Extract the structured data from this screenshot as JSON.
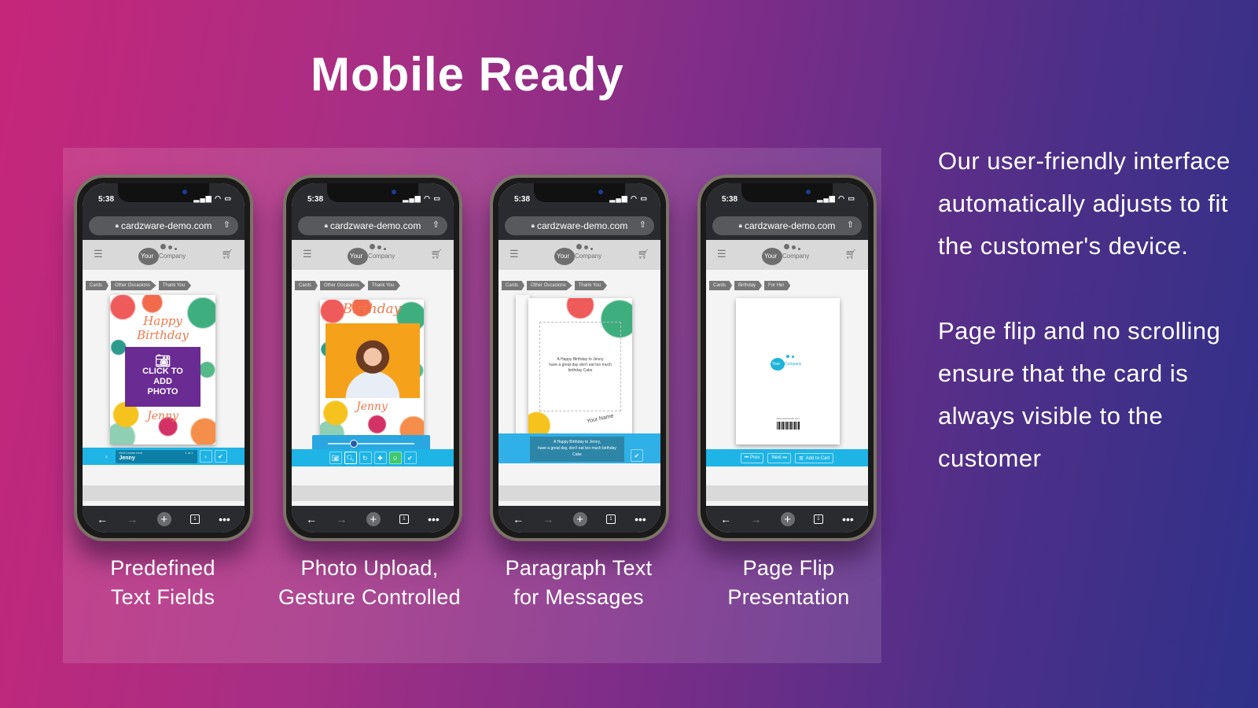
{
  "header": {
    "title": "Mobile Ready"
  },
  "description": {
    "paragraphs": [
      "Our user-friendly interface automatically adjusts to fit the customer's device.",
      "Page flip and no scrolling ensure that the card is always visible to the customer"
    ]
  },
  "browser": {
    "time": "5:38",
    "url": "cardzware-demo.com",
    "status_icons": "signal-icon wifi-icon battery-icon",
    "tab_count": "1"
  },
  "site": {
    "logo_your": "Your",
    "logo_company": "Company"
  },
  "phones": [
    {
      "caption": [
        "Predefined",
        "Text Fields"
      ],
      "breadcrumbs": [
        "Cards",
        "Other Occasions",
        "Thank You"
      ],
      "card": {
        "line1": "Happy",
        "line2": "Birthday",
        "photo_prompt": [
          "CLICK TO",
          "ADD",
          "PHOTO"
        ],
        "name": "Jenny"
      },
      "input": {
        "placeholder": "Enter name here",
        "counter": "1 of 1",
        "value": "Jenny"
      }
    },
    {
      "caption": [
        "Photo Upload,",
        "Gesture Controlled"
      ],
      "breadcrumbs": [
        "Cards",
        "Other Occasions",
        "Thank You"
      ],
      "card": {
        "line1": "Birthday",
        "name": "Jenny"
      },
      "slider": {
        "value": 0.3
      },
      "tools": [
        "camera-icon",
        "zoom-icon",
        "rotate-icon",
        "move-icon",
        "face-icon",
        "check-icon"
      ]
    },
    {
      "caption": [
        "Paragraph Text",
        "for Messages"
      ],
      "breadcrumbs": [
        "Cards",
        "Other Occasions",
        "Thank You"
      ],
      "card": {
        "message": [
          "A Happy Birthday to Jenny",
          "have a great day don't eat too much",
          "birthday Cake"
        ],
        "signature": "Your Name"
      },
      "editor": [
        "A Happy Birthday to Jenny,",
        "have a great day, don't eat too much birthday",
        "Cake"
      ]
    },
    {
      "caption": [
        "Page Flip",
        "Presentation"
      ],
      "breadcrumbs": [
        "Cards",
        "Birthday",
        "For Her"
      ],
      "card": {
        "website": "www.yourdomain.com"
      },
      "buttons": {
        "prev": "Prev",
        "next": "Next",
        "add_to_cart": "Add to Cart"
      }
    }
  ],
  "colors": {
    "accent_blue": "#1eb4e6",
    "photo_purple": "#6a2b93",
    "bg_start": "#c6267a",
    "bg_end": "#2e3189"
  }
}
